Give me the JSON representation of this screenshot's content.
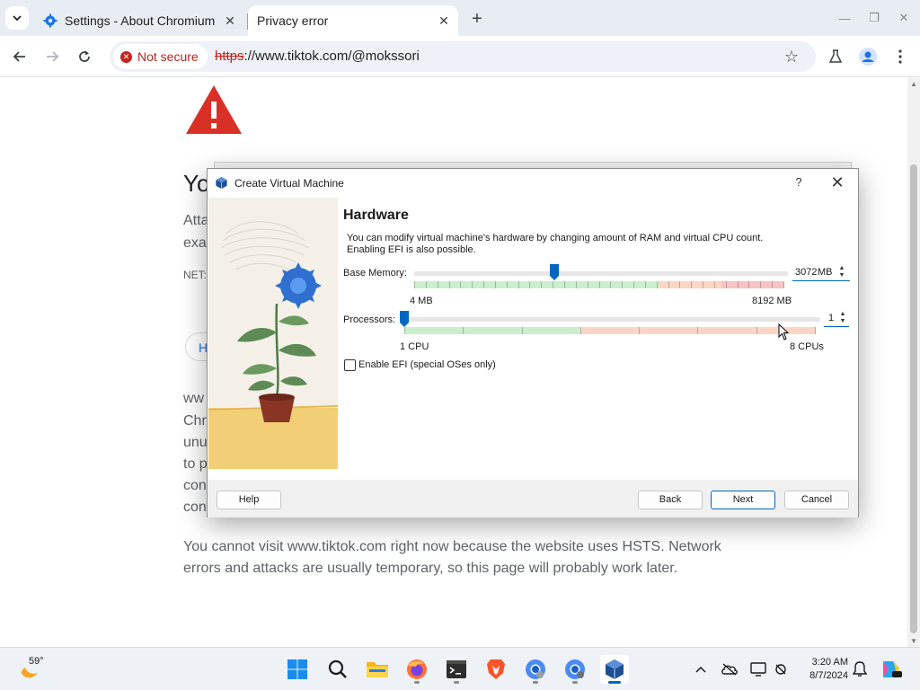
{
  "browser": {
    "tabs": [
      {
        "label": "Settings - About Chromium",
        "icon": "gear-icon"
      },
      {
        "label": "Privacy error",
        "icon": "none"
      }
    ],
    "address": {
      "security_label": "Not secure",
      "url_scheme": "https",
      "url_rest": "://www.tiktok.com/@mokssori"
    }
  },
  "page": {
    "heading_fragment": "Yo",
    "line1_fragment": "Atta",
    "line2_fragment": "exa",
    "error_code_fragment": "NET:",
    "button_fragment": "H",
    "para_fragments": [
      "ww",
      "Chr",
      "unu",
      "to p",
      "con",
      "con"
    ],
    "bottom_text": "You cannot visit www.tiktok.com right now because the website uses HSTS. Network errors and attacks are usually temporary, so this page will probably work later."
  },
  "dialog": {
    "title": "Create Virtual Machine",
    "help_glyph": "?",
    "close_glyph": "✕",
    "heading": "Hardware",
    "description_line1": "You can modify virtual machine's hardware by changing amount of RAM and virtual CPU count.",
    "description_line2": "Enabling EFI is also possible.",
    "memory": {
      "label": "Base Memory:",
      "value": "3072",
      "unit": "MB",
      "min_label": "4 MB",
      "max_label": "8192 MB",
      "min": 4,
      "max": 8192,
      "current": 3072
    },
    "processors": {
      "label": "Processors:",
      "value": "1",
      "min_label": "1 CPU",
      "max_label": "8 CPUs",
      "min": 1,
      "max": 8,
      "current": 1
    },
    "efi": {
      "label": "Enable EFI (special OSes only)",
      "checked": false
    },
    "buttons": {
      "help": "Help",
      "back": "Back",
      "next": "Next",
      "cancel": "Cancel"
    }
  },
  "taskbar": {
    "weather_temp": "59°",
    "apps": [
      "start-icon",
      "search-icon",
      "file-explorer-icon",
      "firefox-icon",
      "terminal-icon",
      "brave-icon",
      "chromium-icon",
      "chromium-alt-icon",
      "virtualbox-icon"
    ],
    "clock_time": "3:20 AM",
    "clock_date": "8/7/2024"
  },
  "colors": {
    "accent": "#0067c0",
    "warning_red": "#d93025",
    "not_secure_red": "#c5221f"
  }
}
